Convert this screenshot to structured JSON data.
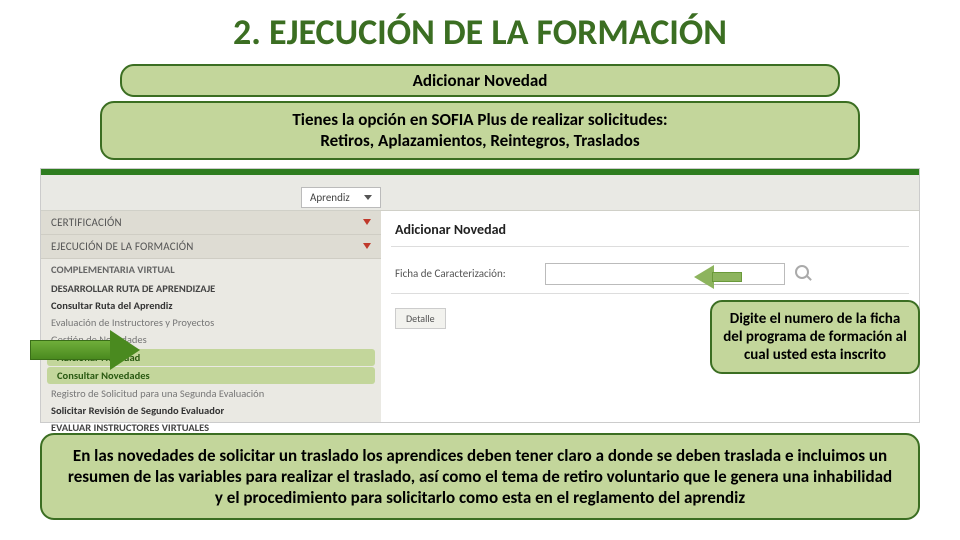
{
  "title": "2. EJECUCIÓN DE LA FORMACIÓN",
  "pill1": "Adicionar Novedad",
  "pill2_line1": "Tienes la opción en SOFIA Plus de realizar solicitudes:",
  "pill2_line2": "Retiros, Aplazamientos, Reintegros, Traslados",
  "callout": "Digite el numero de la ficha del programa de formación al cual usted esta inscrito",
  "bottom": "En las novedades de solicitar un traslado los aprendices deben tener claro a donde se deben traslada e incluimos un resumen de las variables para realizar el traslado, así como el tema de retiro voluntario que le genera una inhabilidad y el procedimiento para solicitarlo como esta en el reglamento del aprendiz",
  "screenshot": {
    "role": "Aprendiz",
    "accordion": {
      "cert": "CERTIFICACIÓN",
      "ejec": "EJECUCIÓN DE LA FORMACIÓN"
    },
    "menu": {
      "comp": "COMPLEMENTARIA VIRTUAL",
      "desarrollar": "DESARROLLAR RUTA DE APRENDIZAJE",
      "consultar_ruta": "Consultar Ruta del Aprendiz",
      "evaluacion": "Evaluación de Instructores y Proyectos",
      "gestion": "Gestión de Novedades",
      "adicionar": "Adicionar Novedad",
      "consultar_nov": "Consultar Novedades",
      "registro": "Registro de Solicitud para una Segunda Evaluación",
      "solicitar_rev": "Solicitar Revisión de Segundo Evaluador",
      "evaluar": "EVALUAR INSTRUCTORES VIRTUALES"
    },
    "panel": {
      "title": "Adicionar Novedad",
      "field_label": "Ficha de Caracterización:",
      "detalle": "Detalle"
    }
  }
}
